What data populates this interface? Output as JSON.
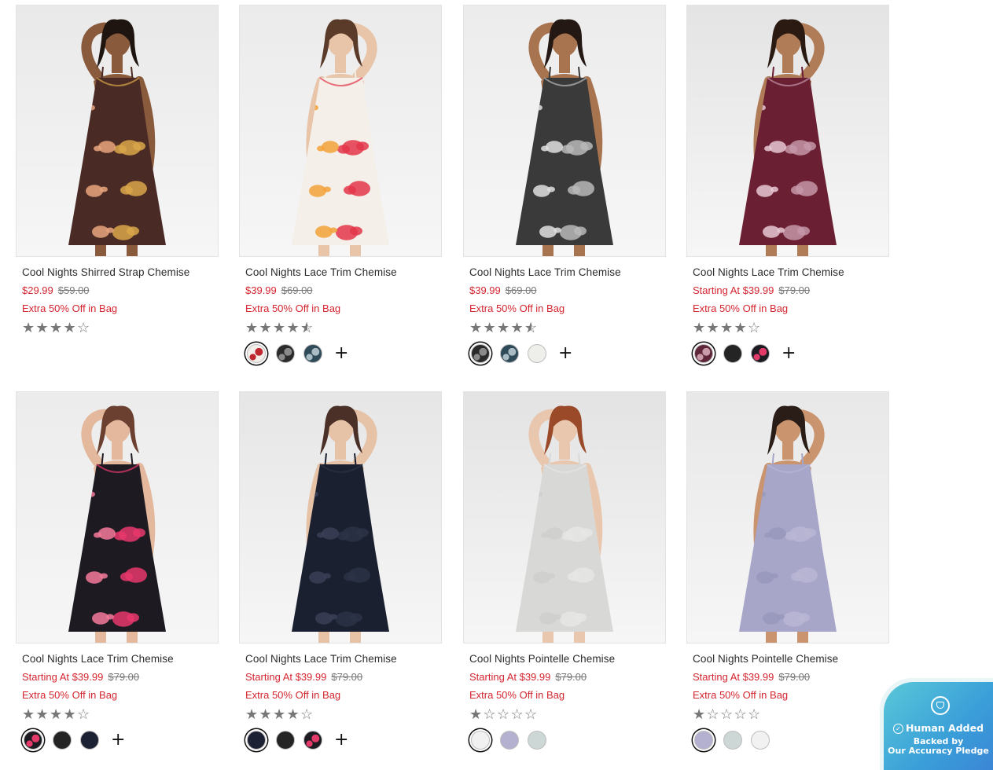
{
  "products": [
    {
      "title": "Cool Nights Shirred Strap Chemise",
      "price": "$29.99",
      "original_price": "$59.00",
      "promo": "Extra 50% Off in Bag",
      "rating": 4,
      "swatches": [],
      "more": "",
      "photo": {
        "bg": "#e9e9e9",
        "dress": "#4a2a24",
        "accent": "#d9a64a",
        "accent2": "#e8a57c",
        "skin": "#8a5a3c",
        "hair": "#1e1410"
      }
    },
    {
      "title": "Cool Nights Lace Trim Chemise",
      "price": "$39.99",
      "original_price": "$69.00",
      "promo": "Extra 50% Off in Bag",
      "rating": 4.5,
      "swatches": [
        {
          "color": "#f3eeea",
          "pattern": "#c0282f",
          "selected": true
        },
        {
          "color": "#2b2b2b",
          "pattern": "#8a8a8a",
          "selected": false
        },
        {
          "color": "#2f4a58",
          "pattern": "#a9bcc4",
          "selected": false
        }
      ],
      "more": "+",
      "photo": {
        "bg": "#ebebeb",
        "dress": "#f4efe8",
        "accent": "#e3364a",
        "accent2": "#f2a23a",
        "skin": "#e8c4a8",
        "hair": "#5a3a28"
      }
    },
    {
      "title": "Cool Nights Lace Trim Chemise",
      "price": "$39.99",
      "original_price": "$69.00",
      "promo": "Extra 50% Off in Bag",
      "rating": 4.5,
      "swatches": [
        {
          "color": "#2b2b2b",
          "pattern": "#8a8a8a",
          "selected": true
        },
        {
          "color": "#2f4a58",
          "pattern": "#a9bcc4",
          "selected": false
        },
        {
          "color": "#eeeeea",
          "pattern": "#eeeeea",
          "selected": false
        }
      ],
      "more": "+",
      "photo": {
        "bg": "#ececec",
        "dress": "#3a3a3a",
        "accent": "#b8b8b8",
        "accent2": "#e0e0e0",
        "skin": "#a8734f",
        "hair": "#241814"
      }
    },
    {
      "title": "Cool Nights Lace Trim Chemise",
      "price": "Starting At $39.99",
      "original_price": "$79.00",
      "promo": "Extra 50% Off in Bag",
      "rating": 4,
      "swatches": [
        {
          "color": "#5e2638",
          "pattern": "#c99aa8",
          "selected": true
        },
        {
          "color": "#242424",
          "pattern": "#242424",
          "selected": false
        },
        {
          "color": "#1c1c22",
          "pattern": "#e33a6a",
          "selected": false
        }
      ],
      "more": "+",
      "photo": {
        "bg": "#e4e4e4",
        "dress": "#6a1f33",
        "accent": "#c497a8",
        "accent2": "#e6c8d2",
        "skin": "#b07c58",
        "hair": "#2a1a12"
      }
    },
    {
      "title": "Cool Nights Lace Trim Chemise",
      "price": "Starting At $39.99",
      "original_price": "$79.00",
      "promo": "Extra 50% Off in Bag",
      "rating": 4,
      "swatches": [
        {
          "color": "#1c1c22",
          "pattern": "#e33a6a",
          "selected": true
        },
        {
          "color": "#242424",
          "pattern": "#242424",
          "selected": false
        },
        {
          "color": "#1c2233",
          "pattern": "#1c2233",
          "selected": false
        }
      ],
      "more": "+",
      "photo": {
        "bg": "#ececec",
        "dress": "#1e1a22",
        "accent": "#e8386c",
        "accent2": "#f47a9a",
        "skin": "#e3b89c",
        "hair": "#6b4030"
      }
    },
    {
      "title": "Cool Nights Lace Trim Chemise",
      "price": "Starting At $39.99",
      "original_price": "$79.00",
      "promo": "Extra 50% Off in Bag",
      "rating": 4,
      "swatches": [
        {
          "color": "#1c2233",
          "pattern": "#1c2233",
          "selected": true
        },
        {
          "color": "#242424",
          "pattern": "#242424",
          "selected": false
        },
        {
          "color": "#1c1c22",
          "pattern": "#e33a6a",
          "selected": false
        }
      ],
      "more": "+",
      "photo": {
        "bg": "#e6e6e6",
        "dress": "#1b2030",
        "accent": "#2c3246",
        "accent2": "#3a4056",
        "skin": "#e6c2a6",
        "hair": "#4a3026"
      }
    },
    {
      "title": "Cool Nights Pointelle Chemise",
      "price": "Starting At $39.99",
      "original_price": "$79.00",
      "promo": "Extra 50% Off in Bag",
      "rating": 1,
      "swatches": [
        {
          "color": "#f1f1f1",
          "pattern": "#f1f1f1",
          "selected": true
        },
        {
          "color": "#b3b1cf",
          "pattern": "#b3b1cf",
          "selected": false
        },
        {
          "color": "#ccd7d6",
          "pattern": "#ccd7d6",
          "selected": false
        }
      ],
      "more": "",
      "photo": {
        "bg": "#e3e3e3",
        "dress": "#d8d8d6",
        "accent": "#e6e6e4",
        "accent2": "#cfcfcc",
        "skin": "#e9c7ae",
        "hair": "#9a4a28"
      }
    },
    {
      "title": "Cool Nights Pointelle Chemise",
      "price": "Starting At $39.99",
      "original_price": "$79.00",
      "promo": "Extra 50% Off in Bag",
      "rating": 1,
      "swatches": [
        {
          "color": "#b3b1cf",
          "pattern": "#b3b1cf",
          "selected": true
        },
        {
          "color": "#ccd7d6",
          "pattern": "#ccd7d6",
          "selected": false
        },
        {
          "color": "#f1f1f1",
          "pattern": "#f1f1f1",
          "selected": false
        }
      ],
      "more": "",
      "photo": {
        "bg": "#e8e8e8",
        "dress": "#a8a6c8",
        "accent": "#b8b6d4",
        "accent2": "#9896bc",
        "skin": "#c9946e",
        "hair": "#2a1c16"
      }
    }
  ],
  "badge": {
    "title": "Human Added",
    "line1": "Backed by",
    "line2": "Our Accuracy Pledge",
    "check": "✓"
  },
  "star_full": "★",
  "star_empty": "☆"
}
